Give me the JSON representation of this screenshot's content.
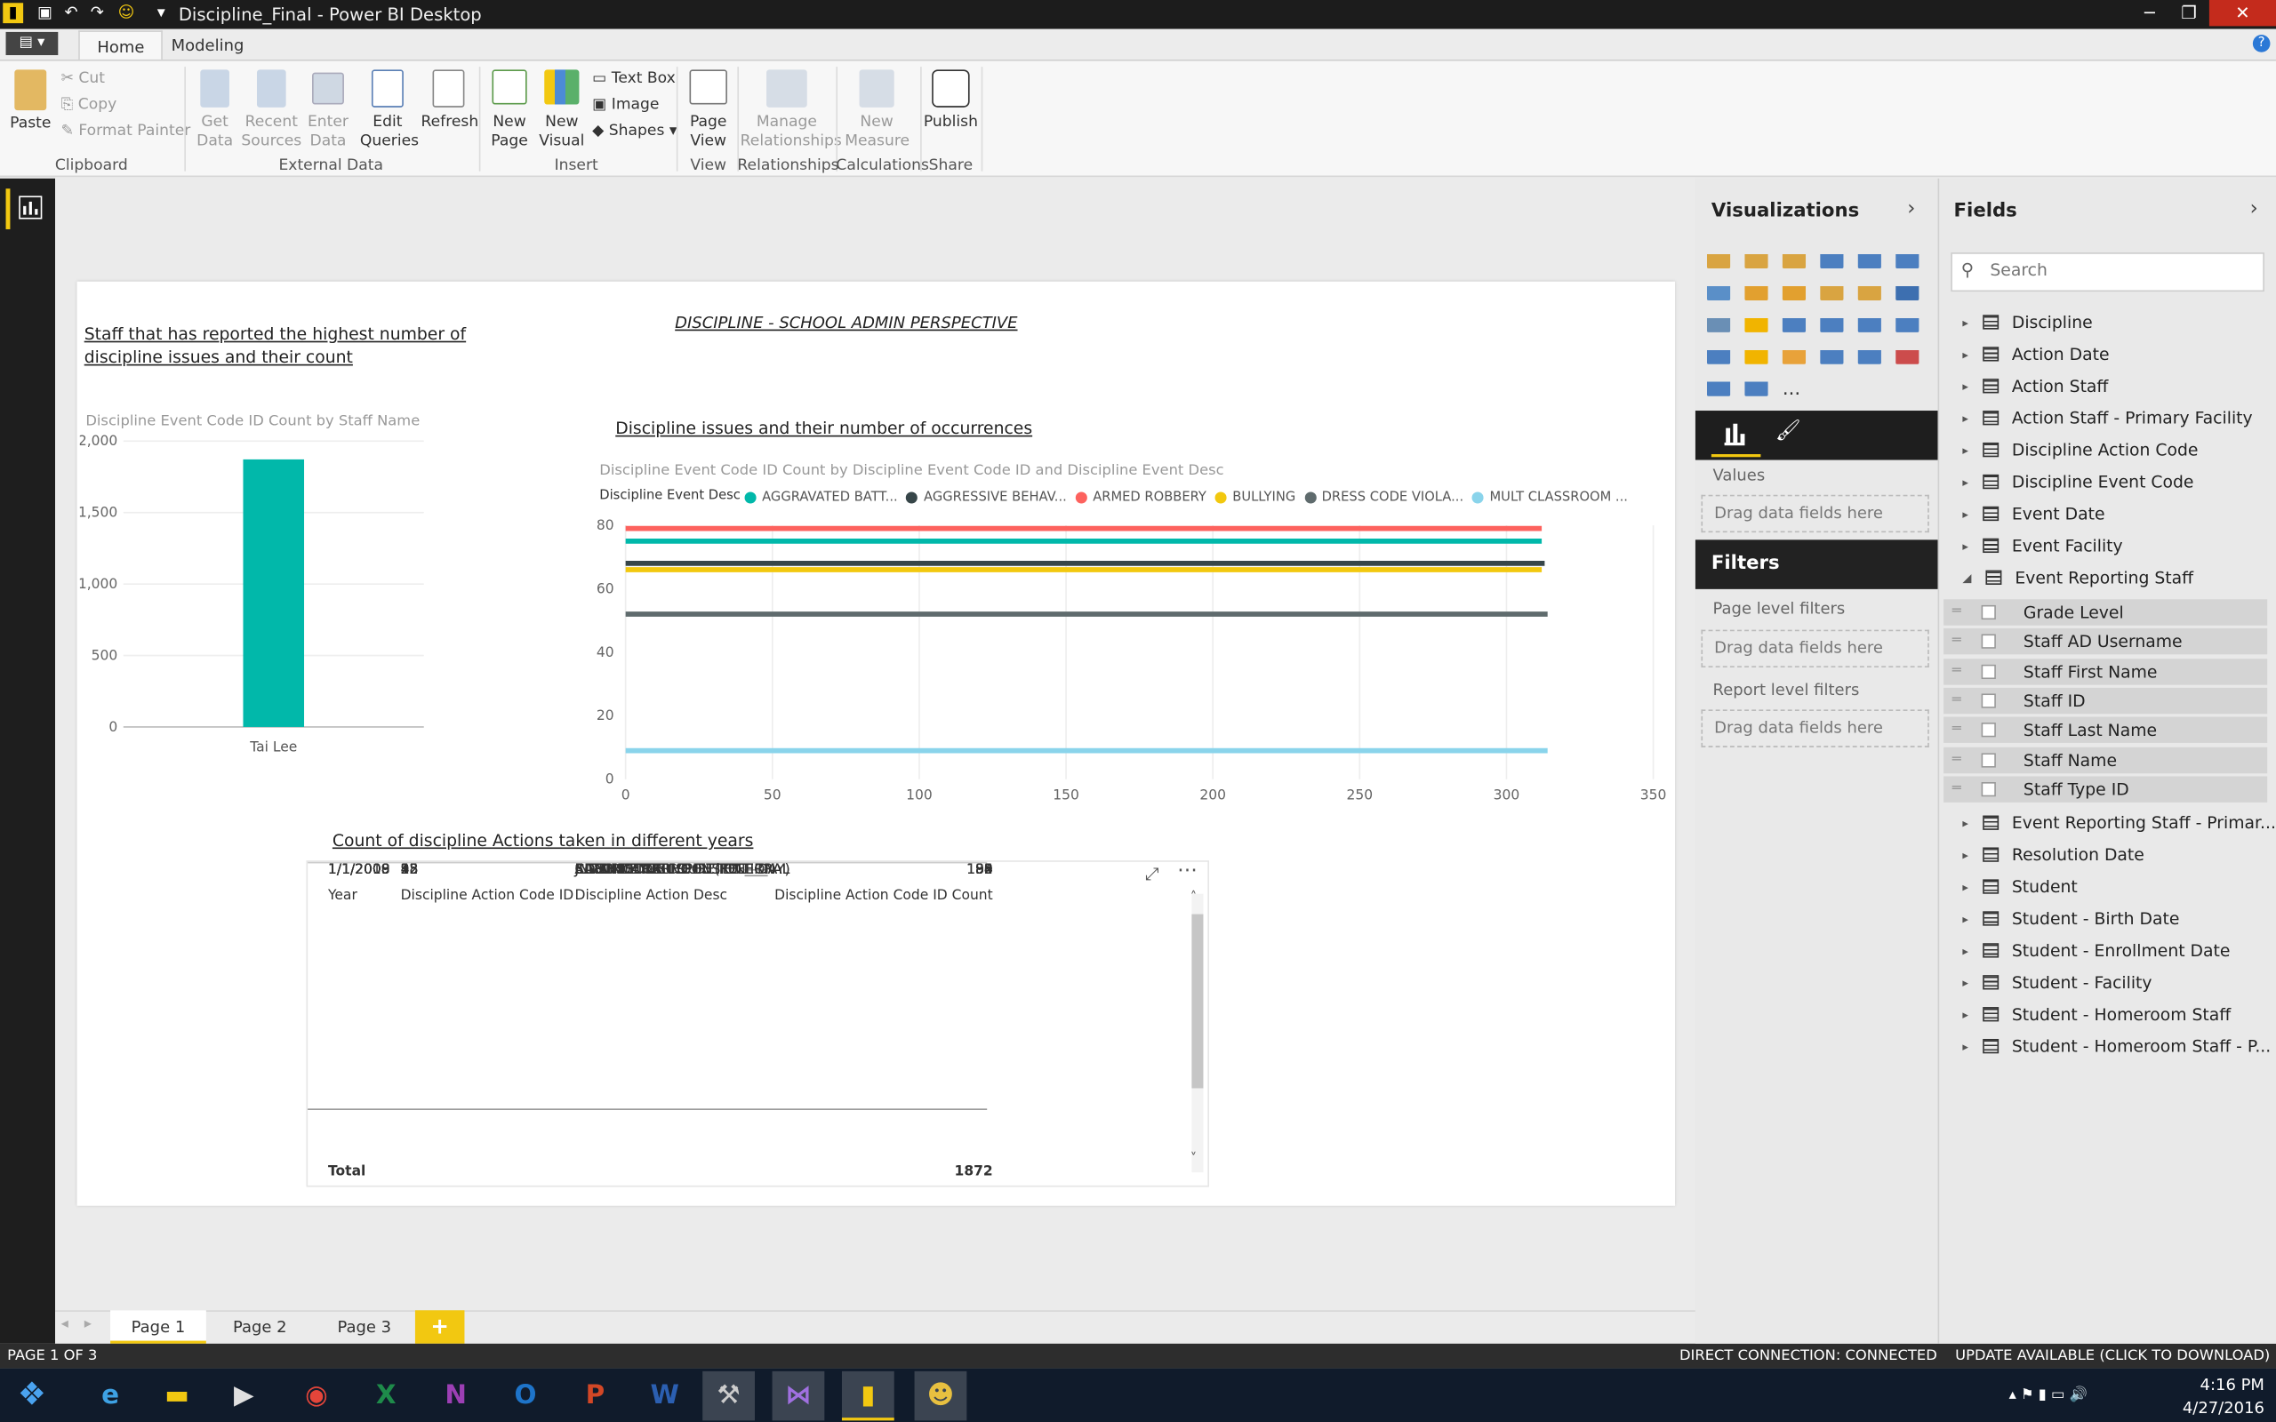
{
  "window": {
    "title": "Discipline_Final - Power BI Desktop"
  },
  "ribbon": {
    "tabs": [
      {
        "label": "Home",
        "active": true
      },
      {
        "label": "Modeling",
        "active": false
      }
    ],
    "clipboard": {
      "paste": "Paste",
      "cut": "Cut",
      "copy": "Copy",
      "format_painter": "Format Painter",
      "group": "Clipboard"
    },
    "external": {
      "get_data": "Get\nData",
      "recent": "Recent\nSources",
      "enter": "Enter\nData",
      "edit": "Edit\nQueries",
      "refresh": "Refresh",
      "group": "External Data"
    },
    "insert": {
      "new_page": "New\nPage",
      "new_visual": "New\nVisual",
      "text_box": "Text Box",
      "image": "Image",
      "shapes": "Shapes",
      "group": "Insert"
    },
    "view": {
      "page_view": "Page\nView",
      "group": "View"
    },
    "relationships": {
      "manage": "Manage\nRelationships",
      "group": "Relationships"
    },
    "calculations": {
      "new_measure": "New\nMeasure",
      "group": "Calculations"
    },
    "share": {
      "publish": "Publish",
      "group": "Share"
    }
  },
  "report": {
    "title": "DISCIPLINE - SCHOOL ADMIN  PERSPECTIVE",
    "visual1_heading": "Staff that has reported the highest number of discipline issues and their count",
    "visual2_heading": "Discipline issues and their number of occurrences",
    "visual3_heading": " Count of discipline Actions taken in different years"
  },
  "bar_chart": {
    "chart_data": {
      "type": "bar",
      "title": "Discipline Event Code ID Count by Staff Name",
      "categories": [
        "Tai Lee"
      ],
      "values": [
        1872
      ],
      "yticks": [
        "2,000",
        "1,500",
        "1,000",
        "500",
        "0"
      ],
      "ylim": [
        0,
        2000
      ],
      "color": "#01b8aa"
    }
  },
  "line_chart": {
    "chart_data": {
      "type": "line",
      "title": "Discipline Event Code ID Count by Discipline Event Code ID and Discipline Event Desc",
      "legend_title": "Discipline Event Desc",
      "xlim": [
        0,
        350
      ],
      "ylim": [
        0,
        80
      ],
      "xticks": [
        "0",
        "50",
        "100",
        "150",
        "200",
        "250",
        "300",
        "350"
      ],
      "yticks": [
        "80",
        "60",
        "40",
        "20",
        "0"
      ],
      "series": [
        {
          "name": "ARMED ROBBERY",
          "color": "#fd625e",
          "y": 79,
          "x": [
            0,
            312
          ]
        },
        {
          "name": "AGGRAVATED BATT...",
          "color": "#01b8aa",
          "y": 75,
          "x": [
            0,
            312
          ]
        },
        {
          "name": "AGGRESSIVE BEHAV...",
          "color": "#374649",
          "y": 68,
          "x": [
            0,
            313
          ]
        },
        {
          "name": "BULLYING",
          "color": "#f2c80f",
          "y": 66,
          "x": [
            0,
            312
          ]
        },
        {
          "name": "DRESS CODE VIOLA...",
          "color": "#5f6b6d",
          "y": 52,
          "x": [
            0,
            314
          ]
        },
        {
          "name": "MULT CLASSROOM ...",
          "color": "#8ad4eb",
          "y": 9,
          "x": [
            0,
            314
          ]
        }
      ],
      "legend": [
        {
          "name": "AGGRAVATED BATT...",
          "color": "#01b8aa"
        },
        {
          "name": "AGGRESSIVE BEHAV...",
          "color": "#374649"
        },
        {
          "name": "ARMED ROBBERY",
          "color": "#fd625e"
        },
        {
          "name": "BULLYING",
          "color": "#f2c80f"
        },
        {
          "name": "DRESS CODE VIOLA...",
          "color": "#5f6b6d"
        },
        {
          "name": "MULT CLASSROOM ...",
          "color": "#8ad4eb"
        }
      ]
    }
  },
  "table": {
    "chart_data": {
      "type": "table",
      "columns": [
        "Year",
        "Discipline Action Code ID",
        "Discipline Action Desc",
        "Discipline Action Code ID Count"
      ],
      "rows": [
        [
          "1/1/2009",
          "35",
          "JUVENILE OR COURT REFERRAL",
          "192"
        ],
        [
          "1/1/2009",
          "2",
          "5 DAY LETTER",
          "190"
        ],
        [
          "1/1/2009",
          "4",
          "ADMINISTRATIVE DETENTION",
          "190"
        ],
        [
          "1/1/2009",
          "9",
          "COUNSELING",
          "190"
        ],
        [
          "1/1/2009",
          "18",
          "IN-SCHOOL SUSPENSION",
          "188"
        ],
        [
          "1/1/2009",
          "32",
          "SATURDAY SCHOOL (FULL DAY)",
          "188"
        ],
        [
          "1/1/2008",
          "2",
          "5 DAY LETTER",
          "85"
        ],
        [
          "1/1/2008",
          "32",
          "SATURDAY SCHOOL (FULL DAY)",
          "85"
        ],
        [
          "1/1/2008",
          "35",
          "JUVENILE OR COURT REFERRAL",
          "85"
        ],
        [
          "1/1/2008",
          "4",
          "ADMINISTRATIVE DETENTION",
          "84"
        ],
        [
          "1/1/2008",
          "9",
          "COUNSELING",
          "84"
        ],
        [
          "1/1/2008",
          "18",
          "IN-SCHOOL SUSPENSION",
          "84"
        ],
        [
          "1/1/2010",
          "18",
          "IN-SCHOOL SUSPENSION",
          "39"
        ]
      ],
      "total_label": "Total",
      "total": "1872"
    }
  },
  "pages": [
    "Page 1",
    "Page 2",
    "Page 3"
  ],
  "add_page": "+",
  "status": {
    "left": "PAGE 1 OF 3",
    "connection": "DIRECT CONNECTION: CONNECTED",
    "update": "UPDATE AVAILABLE (CLICK TO DOWNLOAD)"
  },
  "viz": {
    "title": "Visualizations",
    "values_label": "Values",
    "drag": "Drag data fields here",
    "more": "..."
  },
  "filters": {
    "title": "Filters",
    "page": "Page level filters",
    "report": "Report level filters",
    "drag": "Drag data fields here"
  },
  "fields": {
    "title": "Fields",
    "search_placeholder": "Search",
    "tables": [
      "Discipline",
      "Action Date",
      "Action Staff",
      "Action Staff - Primary Facility",
      "Discipline Action Code",
      "Discipline Event Code",
      "Event Date",
      "Event Facility",
      "Event Reporting Staff"
    ],
    "sub": [
      "Grade Level",
      "Staff AD Username",
      "Staff First Name",
      "Staff ID",
      "Staff Last Name",
      "Staff Name",
      "Staff Type ID"
    ],
    "tables2": [
      "Event Reporting Staff - Primar...",
      "Resolution Date",
      "Student",
      "Student - Birth Date",
      "Student - Enrollment Date",
      "Student - Facility",
      "Student - Homeroom Staff",
      "Student - Homeroom Staff - P..."
    ]
  },
  "taskbar": {
    "time": "4:16 PM",
    "date": "4/27/2016"
  }
}
